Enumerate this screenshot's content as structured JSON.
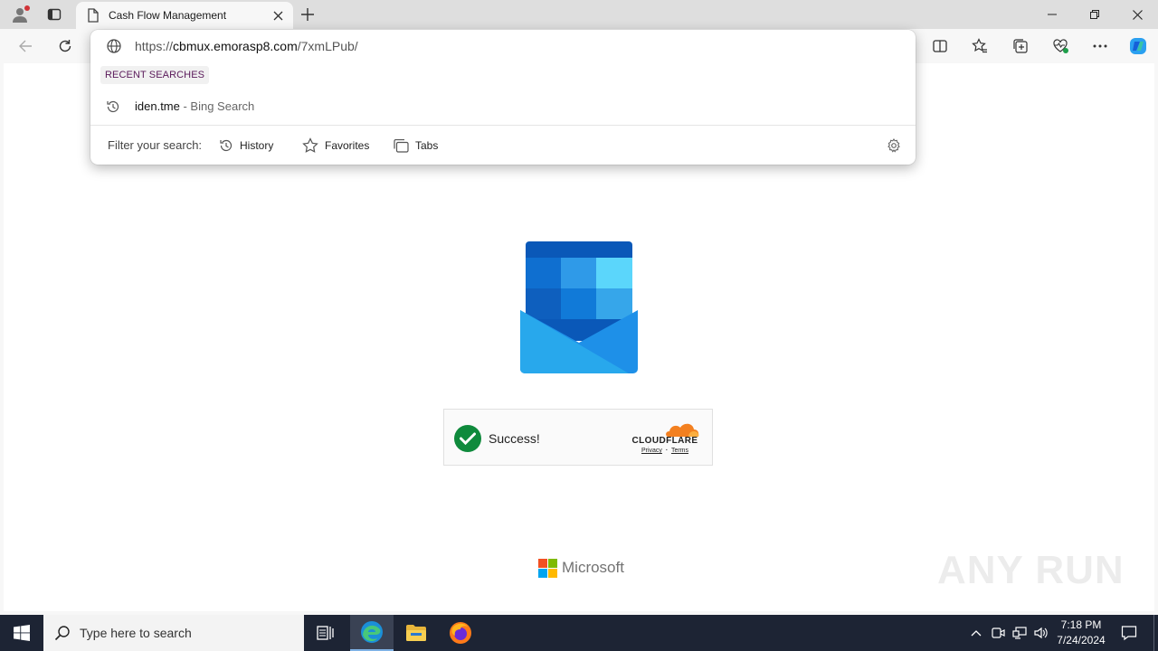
{
  "browser": {
    "tab_title": "Cash Flow Management",
    "url_prefix": "https://",
    "url_host": "cbmux.emorasp8.com",
    "url_path": "/7xmLPub/"
  },
  "omnibox": {
    "recent_label": "RECENT SEARCHES",
    "suggestion_query": "iden.tme",
    "suggestion_source": " - Bing Search",
    "filter_label": "Filter your search:",
    "filter_chips": [
      "History",
      "Favorites",
      "Tabs"
    ]
  },
  "page": {
    "captcha_status": "Success!",
    "captcha_brand": "CLOUDFLARE",
    "captcha_privacy": "Privacy",
    "captcha_separator": "·",
    "captcha_terms": "Terms",
    "footer_brand": "Microsoft",
    "watermark": "ANY RUN"
  },
  "taskbar": {
    "search_placeholder": "Type here to search",
    "time": "7:18 PM",
    "date": "7/24/2024"
  },
  "colors": {
    "accent_edge": "#0078d4",
    "success_green": "#0f8a3c",
    "cloudflare_orange": "#f38020",
    "taskbar_bg": "#1d2434"
  }
}
